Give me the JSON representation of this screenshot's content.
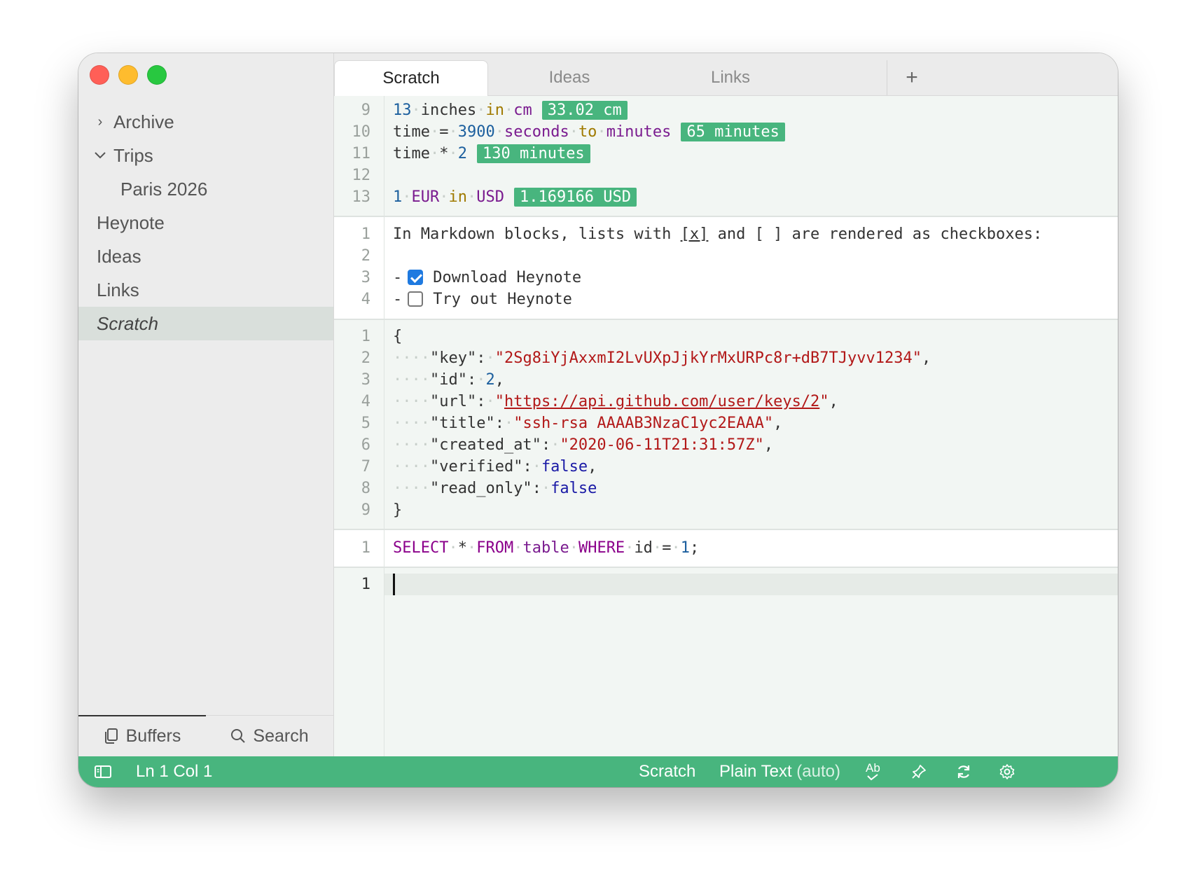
{
  "window": {
    "traffic_lights": {
      "close": "#ff5f57",
      "minimize": "#febc2e",
      "zoom": "#28c840"
    }
  },
  "sidebar": {
    "items": [
      {
        "label": "Archive",
        "chevron": "›"
      },
      {
        "label": "Trips",
        "chevron": "⌄"
      },
      {
        "label": "Paris 2026"
      },
      {
        "label": "Heynote"
      },
      {
        "label": "Ideas"
      },
      {
        "label": "Links"
      },
      {
        "label": "Scratch"
      }
    ],
    "footer": {
      "buffers_label": "Buffers",
      "search_label": "Search"
    }
  },
  "tabs": [
    {
      "label": "Scratch"
    },
    {
      "label": "Ideas"
    },
    {
      "label": "Links"
    }
  ],
  "tab_add": "+",
  "blocks": {
    "math": {
      "line_numbers": [
        "9",
        "10",
        "11",
        "12",
        "13"
      ],
      "l9": {
        "a": "13",
        "b": "inches",
        "c": "in",
        "d": "cm",
        "result": "33.02 cm"
      },
      "l10": {
        "a": "time",
        "b": "=",
        "c": "3900",
        "d": "seconds",
        "e": "to",
        "f": "minutes",
        "result": "65 minutes"
      },
      "l11": {
        "a": "time",
        "b": "*",
        "c": "2",
        "result": "130 minutes"
      },
      "l13": {
        "a": "1",
        "b": "EUR",
        "c": "in",
        "d": "USD",
        "result": "1.169166 USD"
      }
    },
    "markdown": {
      "line_numbers": [
        "1",
        "2",
        "3",
        "4"
      ],
      "intro_a": "In Markdown blocks, lists with ",
      "intro_x": "[x]",
      "intro_b": " and [ ] are rendered as checkboxes:",
      "dash": "-",
      "todo1": "Download Heynote",
      "todo2": "Try out Heynote",
      "todo1_checked": true,
      "todo2_checked": false
    },
    "json": {
      "line_numbers": [
        "1",
        "2",
        "3",
        "4",
        "5",
        "6",
        "7",
        "8",
        "9"
      ],
      "open": "{",
      "close": "}",
      "k_key": "\"key\"",
      "v_key": "\"2Sg8iYjAxxmI2LvUXpJjkYrMxURPc8r+dB7TJyvv1234\"",
      "k_id": "\"id\"",
      "v_id": "2",
      "k_url": "\"url\"",
      "v_url_q": "\"",
      "v_url": "https://api.github.com/user/keys/2",
      "k_title": "\"title\"",
      "v_title": "\"ssh-rsa AAAAB3NzaC1yc2EAAA\"",
      "k_created": "\"created_at\"",
      "v_created": "\"2020-06-11T21:31:57Z\"",
      "k_verified": "\"verified\"",
      "v_verified": "false",
      "k_readonly": "\"read_only\"",
      "v_readonly": "false"
    },
    "sql": {
      "line_numbers": [
        "1"
      ],
      "kw_select": "SELECT",
      "star": "*",
      "kw_from": "FROM",
      "table": "table",
      "kw_where": "WHERE",
      "col": "id",
      "eq": "=",
      "val": "1",
      "semi": ";"
    },
    "text": {
      "line_numbers": [
        "1"
      ]
    }
  },
  "statusbar": {
    "position": "Ln 1 Col 1",
    "buffer": "Scratch",
    "language": "Plain Text",
    "language_auto": "(auto)",
    "spellcheck_icon": "Ab"
  }
}
